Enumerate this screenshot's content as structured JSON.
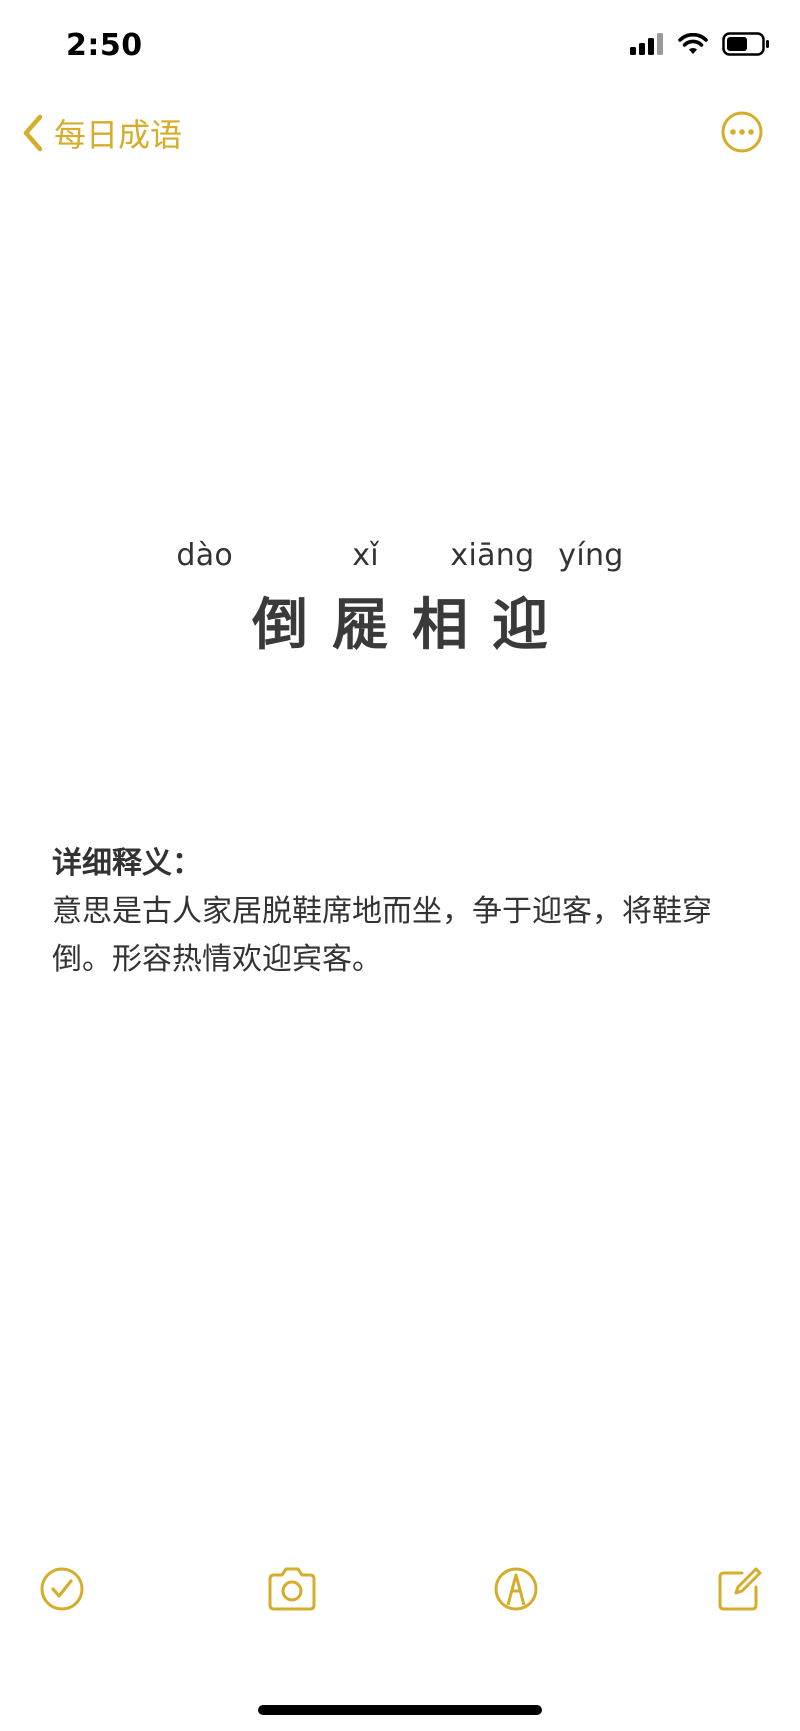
{
  "status_bar": {
    "time": "2:50"
  },
  "nav": {
    "back_label": "每日成语",
    "back_icon": "chevron-left-icon",
    "more_icon": "ellipsis-circle-icon"
  },
  "idiom": {
    "pinyin": "dào     xǐ   xiāng yíng",
    "title": "倒屣相迎"
  },
  "definition": {
    "heading": "详细释义：",
    "body": "意思是古人家居脱鞋席地而坐，争于迎客，将鞋穿倒。形容热情欢迎宾客。"
  },
  "toolbar": {
    "icons": [
      "checklist-icon",
      "camera-icon",
      "markup-icon",
      "compose-icon"
    ]
  },
  "colors": {
    "accent": "#d6ad2a",
    "text": "#333333"
  }
}
